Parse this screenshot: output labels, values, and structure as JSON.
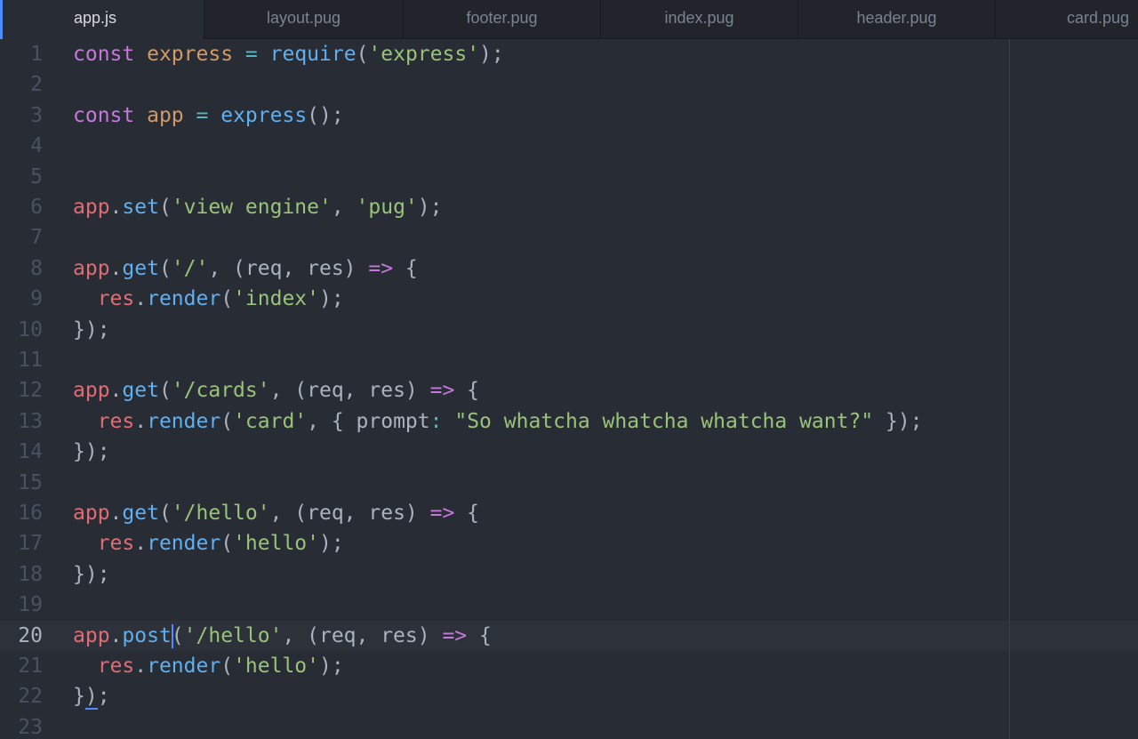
{
  "tabs": [
    {
      "label": "app.js",
      "active": true
    },
    {
      "label": "layout.pug",
      "active": false
    },
    {
      "label": "footer.pug",
      "active": false
    },
    {
      "label": "index.pug",
      "active": false
    },
    {
      "label": "header.pug",
      "active": false
    },
    {
      "label": "card.pug",
      "active": false
    }
  ],
  "cursor_line": 20,
  "lines": [
    {
      "n": "1",
      "tokens": [
        [
          "kw",
          "const"
        ],
        [
          "pl",
          " "
        ],
        [
          "var",
          "express"
        ],
        [
          "pl",
          " "
        ],
        [
          "op",
          "="
        ],
        [
          "pl",
          " "
        ],
        [
          "fn",
          "require"
        ],
        [
          "pun",
          "("
        ],
        [
          "str",
          "'express'"
        ],
        [
          "pun",
          ");"
        ]
      ]
    },
    {
      "n": "2",
      "tokens": []
    },
    {
      "n": "3",
      "tokens": [
        [
          "kw",
          "const"
        ],
        [
          "pl",
          " "
        ],
        [
          "var",
          "app"
        ],
        [
          "pl",
          " "
        ],
        [
          "op",
          "="
        ],
        [
          "pl",
          " "
        ],
        [
          "fn",
          "express"
        ],
        [
          "pun",
          "();"
        ]
      ]
    },
    {
      "n": "4",
      "tokens": []
    },
    {
      "n": "5",
      "tokens": []
    },
    {
      "n": "6",
      "tokens": [
        [
          "obj",
          "app"
        ],
        [
          "pun",
          "."
        ],
        [
          "fn",
          "set"
        ],
        [
          "pun",
          "("
        ],
        [
          "str",
          "'view engine'"
        ],
        [
          "pun",
          ", "
        ],
        [
          "str",
          "'pug'"
        ],
        [
          "pun",
          ");"
        ]
      ]
    },
    {
      "n": "7",
      "tokens": []
    },
    {
      "n": "8",
      "tokens": [
        [
          "obj",
          "app"
        ],
        [
          "pun",
          "."
        ],
        [
          "fn",
          "get"
        ],
        [
          "pun",
          "("
        ],
        [
          "str",
          "'/'"
        ],
        [
          "pun",
          ", (req, res) "
        ],
        [
          "kw",
          "=>"
        ],
        [
          "pun",
          " {"
        ]
      ]
    },
    {
      "n": "9",
      "tokens": [
        [
          "pl",
          "  "
        ],
        [
          "obj",
          "res"
        ],
        [
          "pun",
          "."
        ],
        [
          "fn",
          "render"
        ],
        [
          "pun",
          "("
        ],
        [
          "str",
          "'index'"
        ],
        [
          "pun",
          ");"
        ]
      ]
    },
    {
      "n": "10",
      "tokens": [
        [
          "pun",
          "});"
        ]
      ]
    },
    {
      "n": "11",
      "tokens": []
    },
    {
      "n": "12",
      "tokens": [
        [
          "obj",
          "app"
        ],
        [
          "pun",
          "."
        ],
        [
          "fn",
          "get"
        ],
        [
          "pun",
          "("
        ],
        [
          "str",
          "'/cards'"
        ],
        [
          "pun",
          ", (req, res) "
        ],
        [
          "kw",
          "=>"
        ],
        [
          "pun",
          " {"
        ]
      ]
    },
    {
      "n": "13",
      "tokens": [
        [
          "pl",
          "  "
        ],
        [
          "obj",
          "res"
        ],
        [
          "pun",
          "."
        ],
        [
          "fn",
          "render"
        ],
        [
          "pun",
          "("
        ],
        [
          "str",
          "'card'"
        ],
        [
          "pun",
          ", { prompt"
        ],
        [
          "op",
          ":"
        ],
        [
          "pl",
          " "
        ],
        [
          "str",
          "\"So whatcha whatcha whatcha want?\""
        ],
        [
          "pun",
          " });"
        ]
      ]
    },
    {
      "n": "14",
      "tokens": [
        [
          "pun",
          "});"
        ]
      ]
    },
    {
      "n": "15",
      "tokens": []
    },
    {
      "n": "16",
      "tokens": [
        [
          "obj",
          "app"
        ],
        [
          "pun",
          "."
        ],
        [
          "fn",
          "get"
        ],
        [
          "pun",
          "("
        ],
        [
          "str",
          "'/hello'"
        ],
        [
          "pun",
          ", (req, res) "
        ],
        [
          "kw",
          "=>"
        ],
        [
          "pun",
          " {"
        ]
      ]
    },
    {
      "n": "17",
      "tokens": [
        [
          "pl",
          "  "
        ],
        [
          "obj",
          "res"
        ],
        [
          "pun",
          "."
        ],
        [
          "fn",
          "render"
        ],
        [
          "pun",
          "("
        ],
        [
          "str",
          "'hello'"
        ],
        [
          "pun",
          ");"
        ]
      ]
    },
    {
      "n": "18",
      "tokens": [
        [
          "pun",
          "});"
        ]
      ]
    },
    {
      "n": "19",
      "tokens": []
    },
    {
      "n": "20",
      "tokens": [
        [
          "obj",
          "app"
        ],
        [
          "pun",
          "."
        ],
        [
          "fn",
          "post"
        ],
        [
          "caret",
          ""
        ],
        [
          "pun",
          "("
        ],
        [
          "str",
          "'/hello'"
        ],
        [
          "pun",
          ", (req, res) "
        ],
        [
          "kw",
          "=>"
        ],
        [
          "pun",
          " {"
        ]
      ]
    },
    {
      "n": "21",
      "tokens": [
        [
          "pl",
          "  "
        ],
        [
          "obj",
          "res"
        ],
        [
          "pun",
          "."
        ],
        [
          "fn",
          "render"
        ],
        [
          "pun",
          "("
        ],
        [
          "str",
          "'hello'"
        ],
        [
          "pun",
          ");"
        ]
      ]
    },
    {
      "n": "22",
      "tokens": [
        [
          "pun",
          "}"
        ],
        [
          "match",
          ")"
        ],
        [
          "pun",
          ";"
        ]
      ]
    },
    {
      "n": "23",
      "tokens": []
    }
  ]
}
